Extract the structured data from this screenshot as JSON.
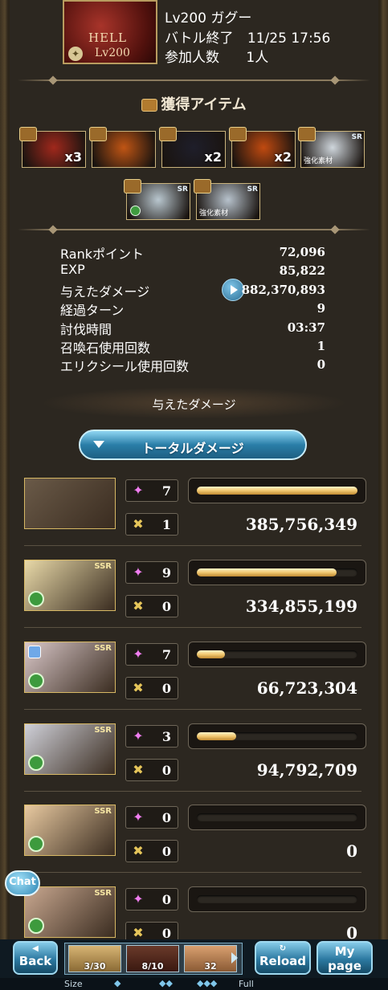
{
  "header": {
    "quest_name": "Lv200 ガグー",
    "battle_end_label": "バトル終了",
    "battle_end_time": "11/25 17:56",
    "participants_label": "参加人数",
    "participants_value": "1人",
    "thumb_title": "HELL",
    "thumb_level": "Lv200"
  },
  "items_section": {
    "title": "獲得アイテム",
    "row1": [
      {
        "name": "gold-medal-item",
        "count": "x3",
        "color": "#a0281c"
      },
      {
        "name": "book-item",
        "count": "",
        "color": "#c05514"
      },
      {
        "name": "red-gem-item",
        "count": "x2",
        "color": "#1e1e2a"
      },
      {
        "name": "flame-item",
        "count": "x2",
        "color": "#c04a10"
      },
      {
        "name": "ssr-claw-item",
        "count": "",
        "tag": "強化素材",
        "ssr": "SR",
        "color": "#cfd6dc"
      }
    ],
    "row2": [
      {
        "name": "ssr-gun-item",
        "ssr": "SR",
        "color": "#b9c7cf"
      },
      {
        "name": "ssr-blade-item",
        "ssr": "SR",
        "tag": "強化素材",
        "color": "#b7c2cc"
      }
    ]
  },
  "stats": {
    "rank_label": "Rankポイント",
    "rank_value": "72,096",
    "exp_label": "EXP",
    "exp_value": "85,822",
    "damage_label": "与えたダメージ",
    "damage_value": "882,370,893",
    "turns_label": "経過ターン",
    "turns_value": "9",
    "time_label": "討伐時間",
    "time_value": "03:37",
    "summon_label": "召喚石使用回数",
    "summon_value": "1",
    "elixir_label": "エリクシール使用回数",
    "elixir_value": "0"
  },
  "damage_section": {
    "title": "与えたダメージ",
    "dropdown_label": "トータルダメージ"
  },
  "members": [
    {
      "ca": "7",
      "chain": "1",
      "damage": "385,756,349",
      "fill": 1.0,
      "ssr": "",
      "portrait_color": "#6a5a48"
    },
    {
      "ca": "9",
      "chain": "0",
      "damage": "334,855,199",
      "fill": 0.868,
      "ssr": "SSR",
      "portrait_color": "#e8d9a8"
    },
    {
      "ca": "7",
      "chain": "0",
      "damage": "66,723,304",
      "fill": 0.173,
      "ssr": "SSR",
      "portrait_color": "#d9c7c8"
    },
    {
      "ca": "3",
      "chain": "0",
      "damage": "94,792,709",
      "fill": 0.246,
      "ssr": "SSR",
      "portrait_color": "#cfd0d8"
    },
    {
      "ca": "0",
      "chain": "0",
      "damage": "0",
      "fill": 0.0,
      "ssr": "SSR",
      "portrait_color": "#e8c9a0"
    },
    {
      "ca": "0",
      "chain": "0",
      "damage": "0",
      "fill": 0.0,
      "ssr": "SSR",
      "portrait_color": "#c9a890"
    }
  ],
  "footer": {
    "back_top": "◀",
    "back_label": "Back",
    "reload_top": "↻",
    "reload_label": "Reload",
    "mypage_top": "My",
    "mypage_label": "page",
    "slots": [
      "3/30",
      "8/10",
      "32"
    ],
    "size_label": "Size",
    "full_label": "Full"
  },
  "chat_label": "Chat"
}
